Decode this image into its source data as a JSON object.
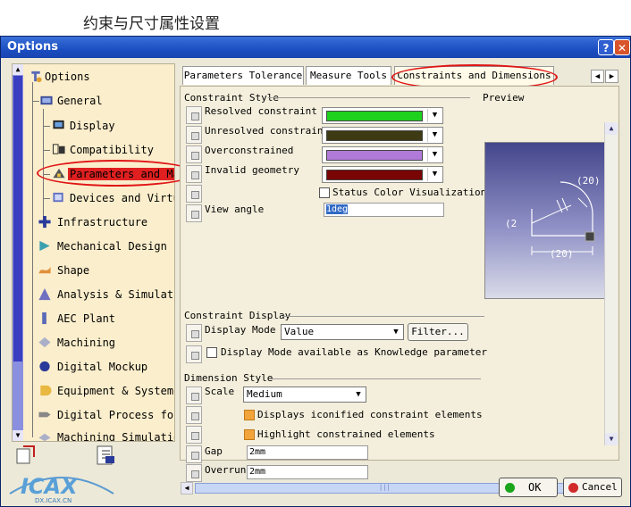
{
  "caption": "约束与尺寸属性设置",
  "window": {
    "title": "Options",
    "help": "?",
    "close": "✕"
  },
  "tree": {
    "up": "▲",
    "down": "▼",
    "items": [
      {
        "label": "Options"
      },
      {
        "label": "General"
      },
      {
        "label": "Display"
      },
      {
        "label": "Compatibility"
      },
      {
        "label": "Parameters and Ma"
      },
      {
        "label": "Devices and Virtu"
      },
      {
        "label": "Infrastructure"
      },
      {
        "label": "Mechanical Design"
      },
      {
        "label": "Shape"
      },
      {
        "label": "Analysis & Simulati"
      },
      {
        "label": "AEC Plant"
      },
      {
        "label": "Machining"
      },
      {
        "label": "Digital Mockup"
      },
      {
        "label": "Equipment & Systems"
      },
      {
        "label": "Digital Process for"
      },
      {
        "label": "Machining Simulatio"
      }
    ]
  },
  "tabs": [
    "Parameters Tolerance",
    "Measure Tools",
    "Constraints and Dimensions"
  ],
  "tab_left": "◀",
  "tab_right": "▶",
  "constraint_style": {
    "title": "Constraint Style",
    "rows": [
      {
        "label": "Resolved constraint",
        "color": "#1fd11f"
      },
      {
        "label": "Unresolved constraint",
        "color": "#3e3a14"
      },
      {
        "label": "Overconstrained",
        "color": "#b27ad8"
      },
      {
        "label": "Invalid geometry",
        "color": "#7a0505"
      }
    ],
    "status_color": "Status Color Visualization",
    "view_angle_label": "View angle",
    "view_angle_value": "1deg",
    "dd": "▼"
  },
  "preview": {
    "title": "Preview",
    "dim_arc": "(20)",
    "dim_left": "(2",
    "dim_bottom": "(20)"
  },
  "constraint_display": {
    "title": "Constraint Display",
    "mode_label": "Display Mode",
    "mode_value": "Value",
    "filter": "Filter...",
    "knowledge": "Display Mode available as Knowledge parameter"
  },
  "dimension_style": {
    "title": "Dimension Style",
    "scale_label": "Scale",
    "scale_value": "Medium",
    "iconified": "Displays iconified constraint elements",
    "highlight": "Highlight constrained elements",
    "gap_label": "Gap",
    "gap_value": "2mm",
    "overrun_label": "Overrun",
    "overrun_value": "2mm"
  },
  "scroll": {
    "up": "▲",
    "down": "▼",
    "left": "◀",
    "right": "▶",
    "grip": "|||"
  },
  "buttons": {
    "ok": "OK",
    "cancel": "Cancel"
  },
  "watermark": {
    "text": "ICAX",
    "url": "DX.ICAX.CN"
  },
  "colors": {
    "titlebar": "#1c4fc2",
    "highlight": "#e02020",
    "annotation": "#e01616",
    "ok_dot": "#1aa51a",
    "cancel_dot": "#d12a2a"
  }
}
